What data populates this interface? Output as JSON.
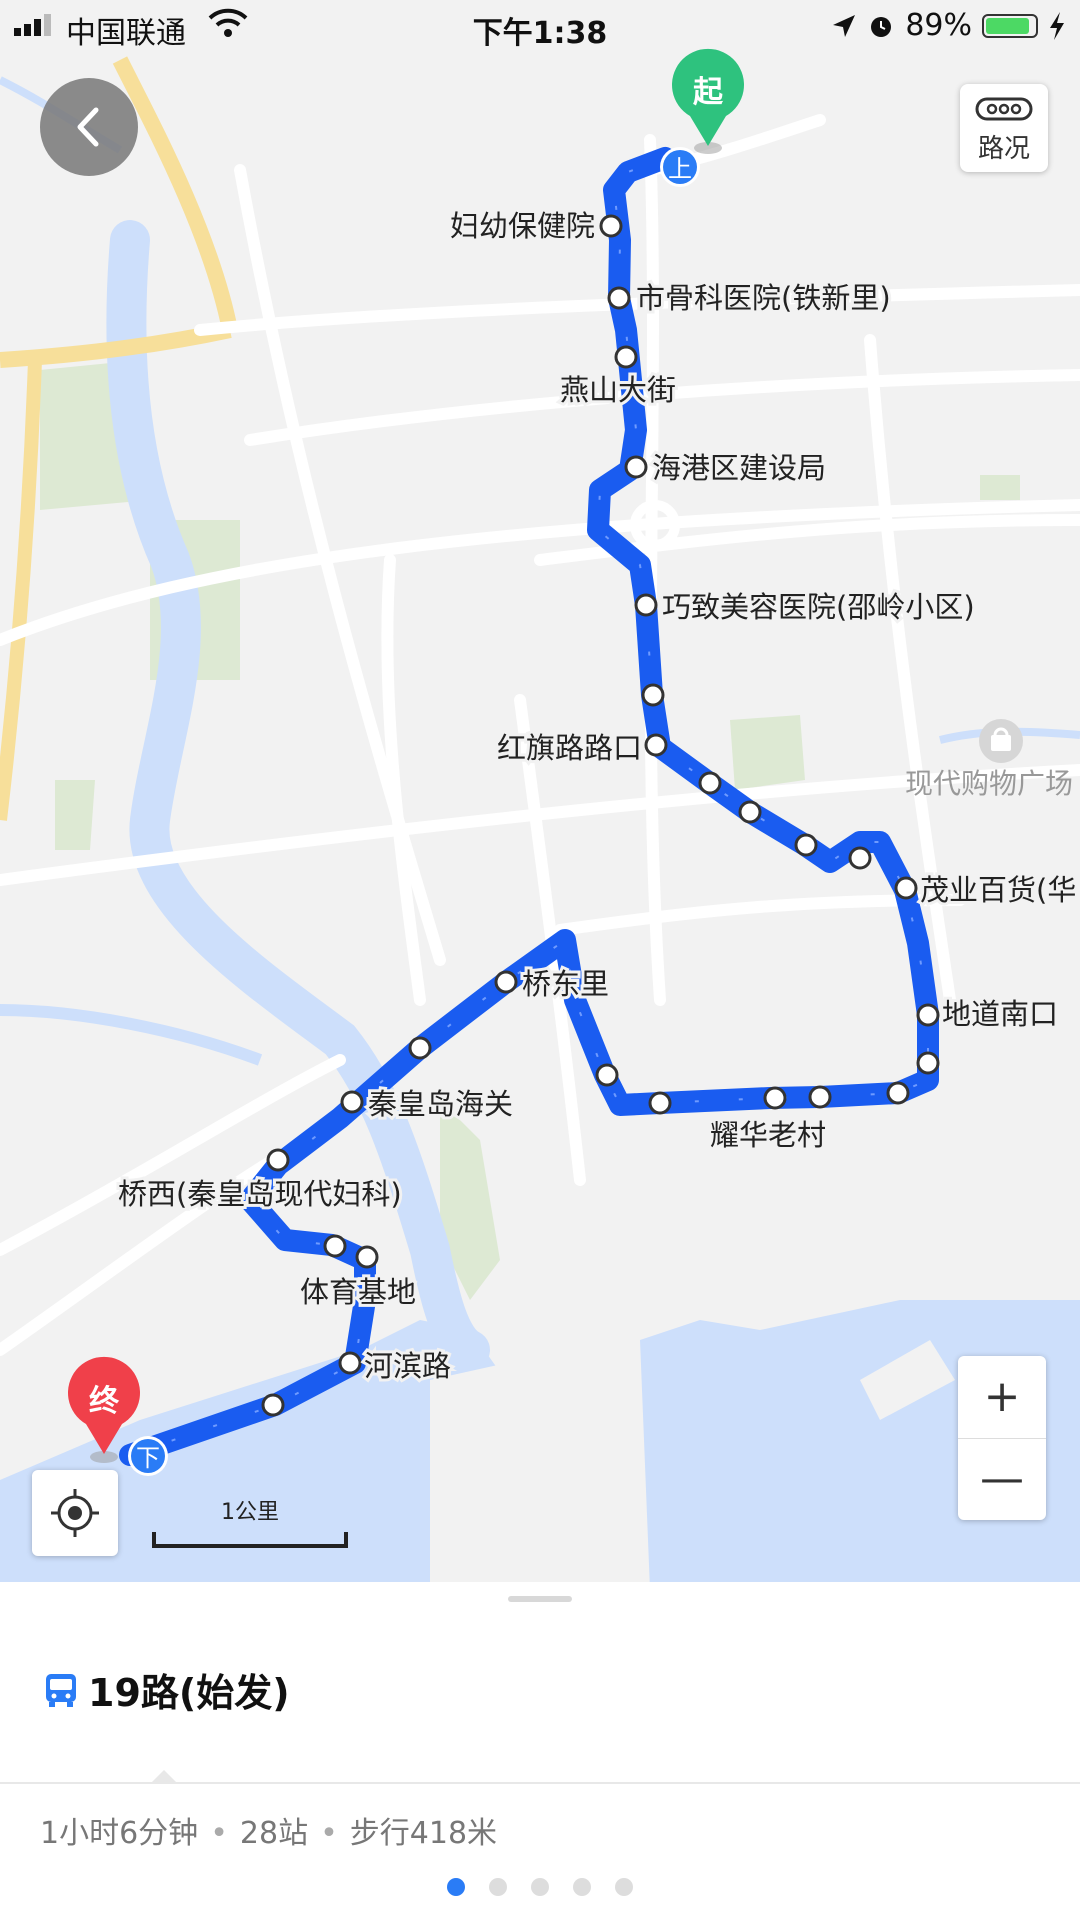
{
  "status_bar": {
    "carrier": "中国联通",
    "time": "下午1:38",
    "battery_percent": "89%",
    "battery_level": 0.89
  },
  "map": {
    "traffic_label": "路况",
    "start_marker": "起",
    "end_marker": "终",
    "board_marker": "上",
    "alight_marker": "下",
    "poi_label": "现代购物广场",
    "scale_label": "1公里",
    "zoom_in": "+",
    "zoom_out": "—",
    "stop_labels": [
      "妇幼保健院",
      "市骨科医院(铁新里)",
      "燕山大街",
      "海港区建设局",
      "巧致美容医院(邵岭小区)",
      "红旗路路口",
      "茂业百货(华",
      "地道南口",
      "耀华老村",
      "桥东里",
      "秦皇岛海关",
      "桥西(秦皇岛现代妇科)",
      "体育基地",
      "河滨路"
    ],
    "colors": {
      "route": "#1a5cf0",
      "water": "#cddffb",
      "land": "#f2f2f2",
      "start": "#2ec27e",
      "end": "#f0404a"
    }
  },
  "sheet": {
    "route_name": "19路(始发)",
    "duration": "1小时6分钟",
    "stops": "28站",
    "walk": "步行418米",
    "page_count": 5,
    "active_page": 0
  }
}
